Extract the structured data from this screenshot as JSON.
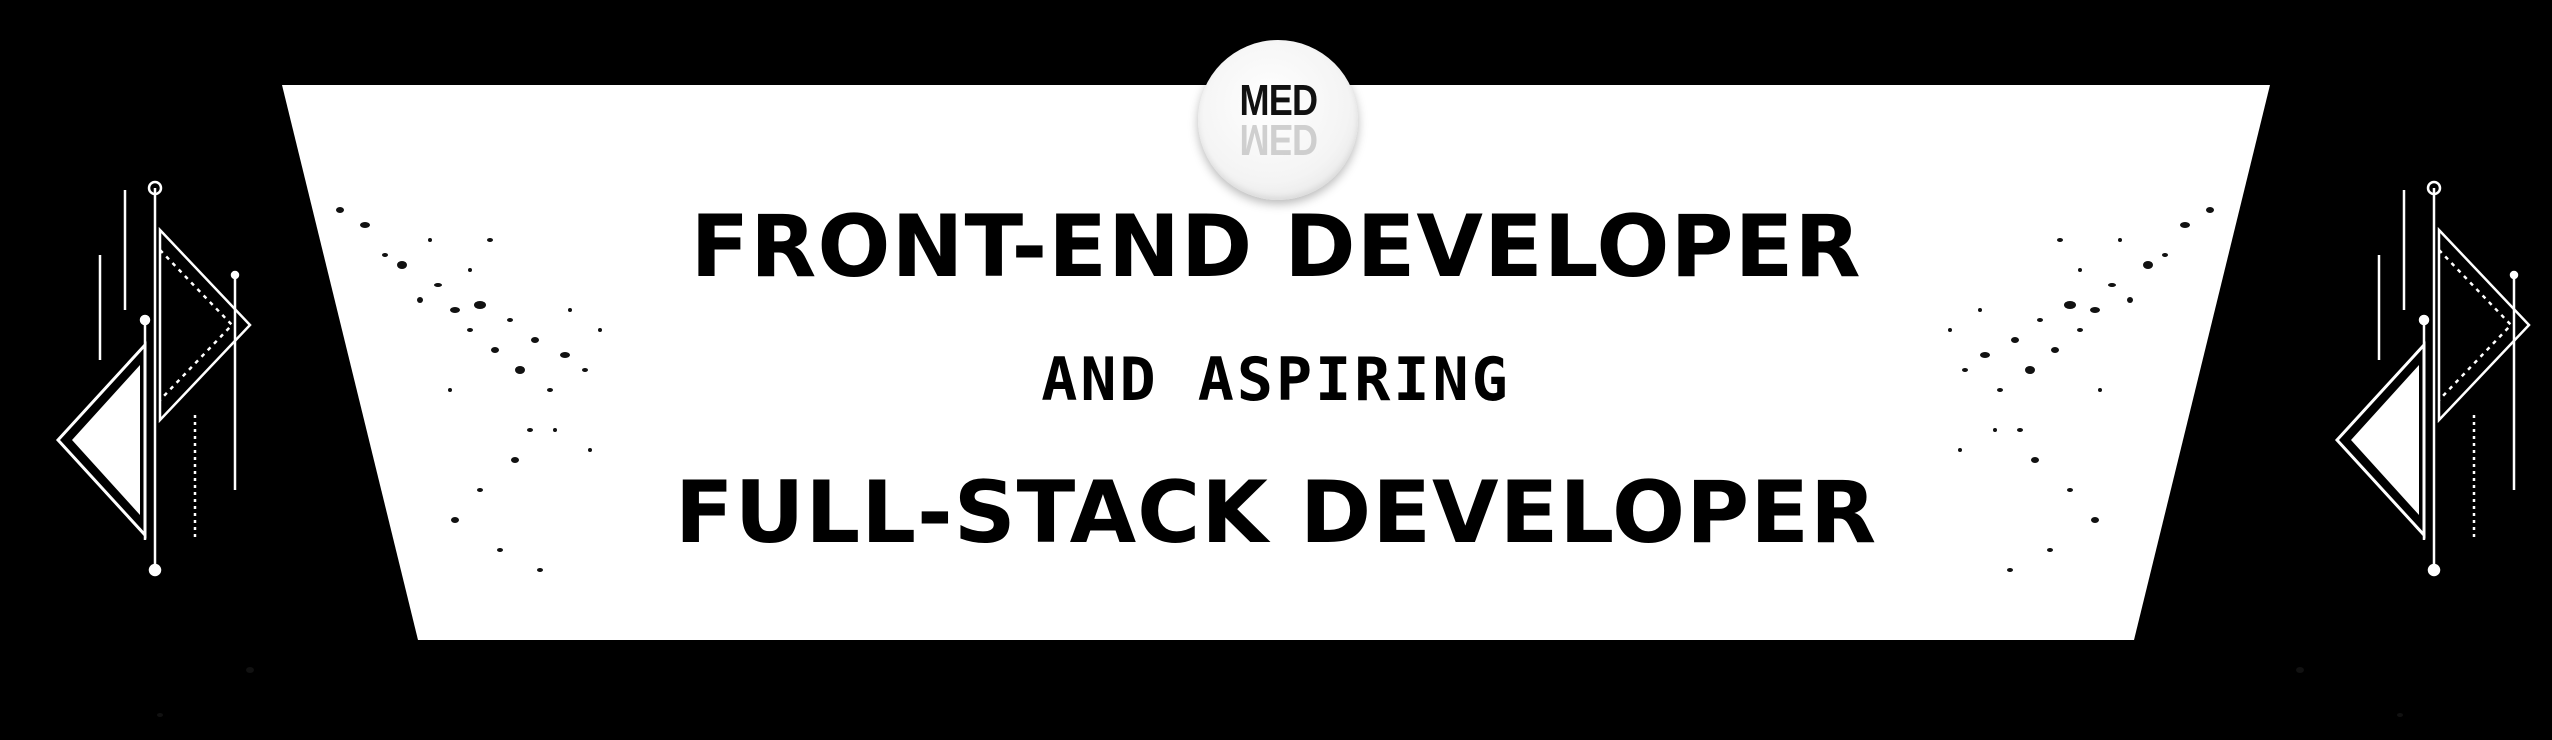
{
  "banner": {
    "logo": {
      "text": "MED",
      "reflection_text": "MED"
    },
    "headline_line1": "FRONT-END DEVELOPER",
    "headline_line2": "AND ASPIRING",
    "headline_line3": "FULL-STACK DEVELOPER"
  },
  "colors": {
    "background": "#ffffff",
    "ink": "#000000",
    "border": "#000000"
  },
  "icons": [
    "geometric-triangle-art-left",
    "geometric-triangle-art-right",
    "ink-splatter-left",
    "ink-splatter-right",
    "med-logo"
  ]
}
